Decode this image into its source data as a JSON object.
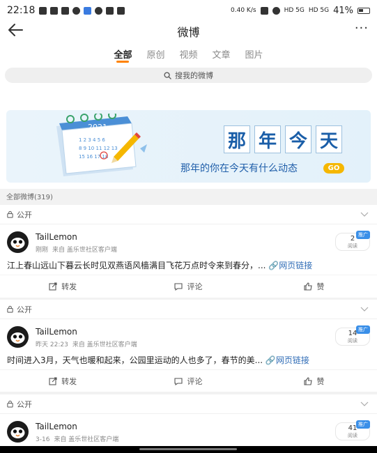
{
  "status_bar": {
    "time": "22:18",
    "net_speed": "0.40 K/s",
    "net_type1": "HD 5G",
    "net_type2": "HD 5G",
    "battery": "41%"
  },
  "header": {
    "title": "微博",
    "more": "···"
  },
  "tabs": [
    {
      "label": "全部",
      "active": true
    },
    {
      "label": "原创",
      "active": false
    },
    {
      "label": "视频",
      "active": false
    },
    {
      "label": "文章",
      "active": false
    },
    {
      "label": "图片",
      "active": false
    }
  ],
  "search": {
    "placeholder": "搜我的微博"
  },
  "banner": {
    "title_chars": [
      "那",
      "年",
      "今",
      "天"
    ],
    "subtitle": "那年的你在今天有什么动态",
    "go": "GO",
    "calendar_year": "2021"
  },
  "count_label": "全部微博(319)",
  "posts": [
    {
      "visibility": "公开",
      "user": "TailLemon",
      "time": "刚刚",
      "source": "来自 盖乐世社区客户端",
      "reads": "2",
      "reads_label": "阅读",
      "promo": "推广",
      "text": "江上春山远山下暮云长时见双燕语风樯满目飞花万点时令来到春分，...",
      "link": "网页链接",
      "repost": "转发",
      "comment": "评论",
      "like": "赞"
    },
    {
      "visibility": "公开",
      "user": "TailLemon",
      "time": "昨天 22:23",
      "source": "来自 盖乐世社区客户端",
      "reads": "14",
      "reads_label": "阅读",
      "promo": "推广",
      "text": "时间进入3月，天气也暖和起来，公园里运动的人也多了，春节的美...",
      "link": "网页链接",
      "repost": "转发",
      "comment": "评论",
      "like": "赞"
    },
    {
      "visibility": "公开",
      "user": "TailLemon",
      "time": "3-16",
      "source": "来自 盖乐世社区客户端",
      "reads": "41",
      "reads_label": "阅读",
      "promo": "推广"
    }
  ],
  "icons": {
    "back": "arrow-left-icon",
    "search": "search-icon",
    "lock": "lock-icon",
    "chevron": "chevron-down-icon",
    "repost": "repost-icon",
    "comment": "comment-icon",
    "like": "thumbs-up-icon"
  }
}
